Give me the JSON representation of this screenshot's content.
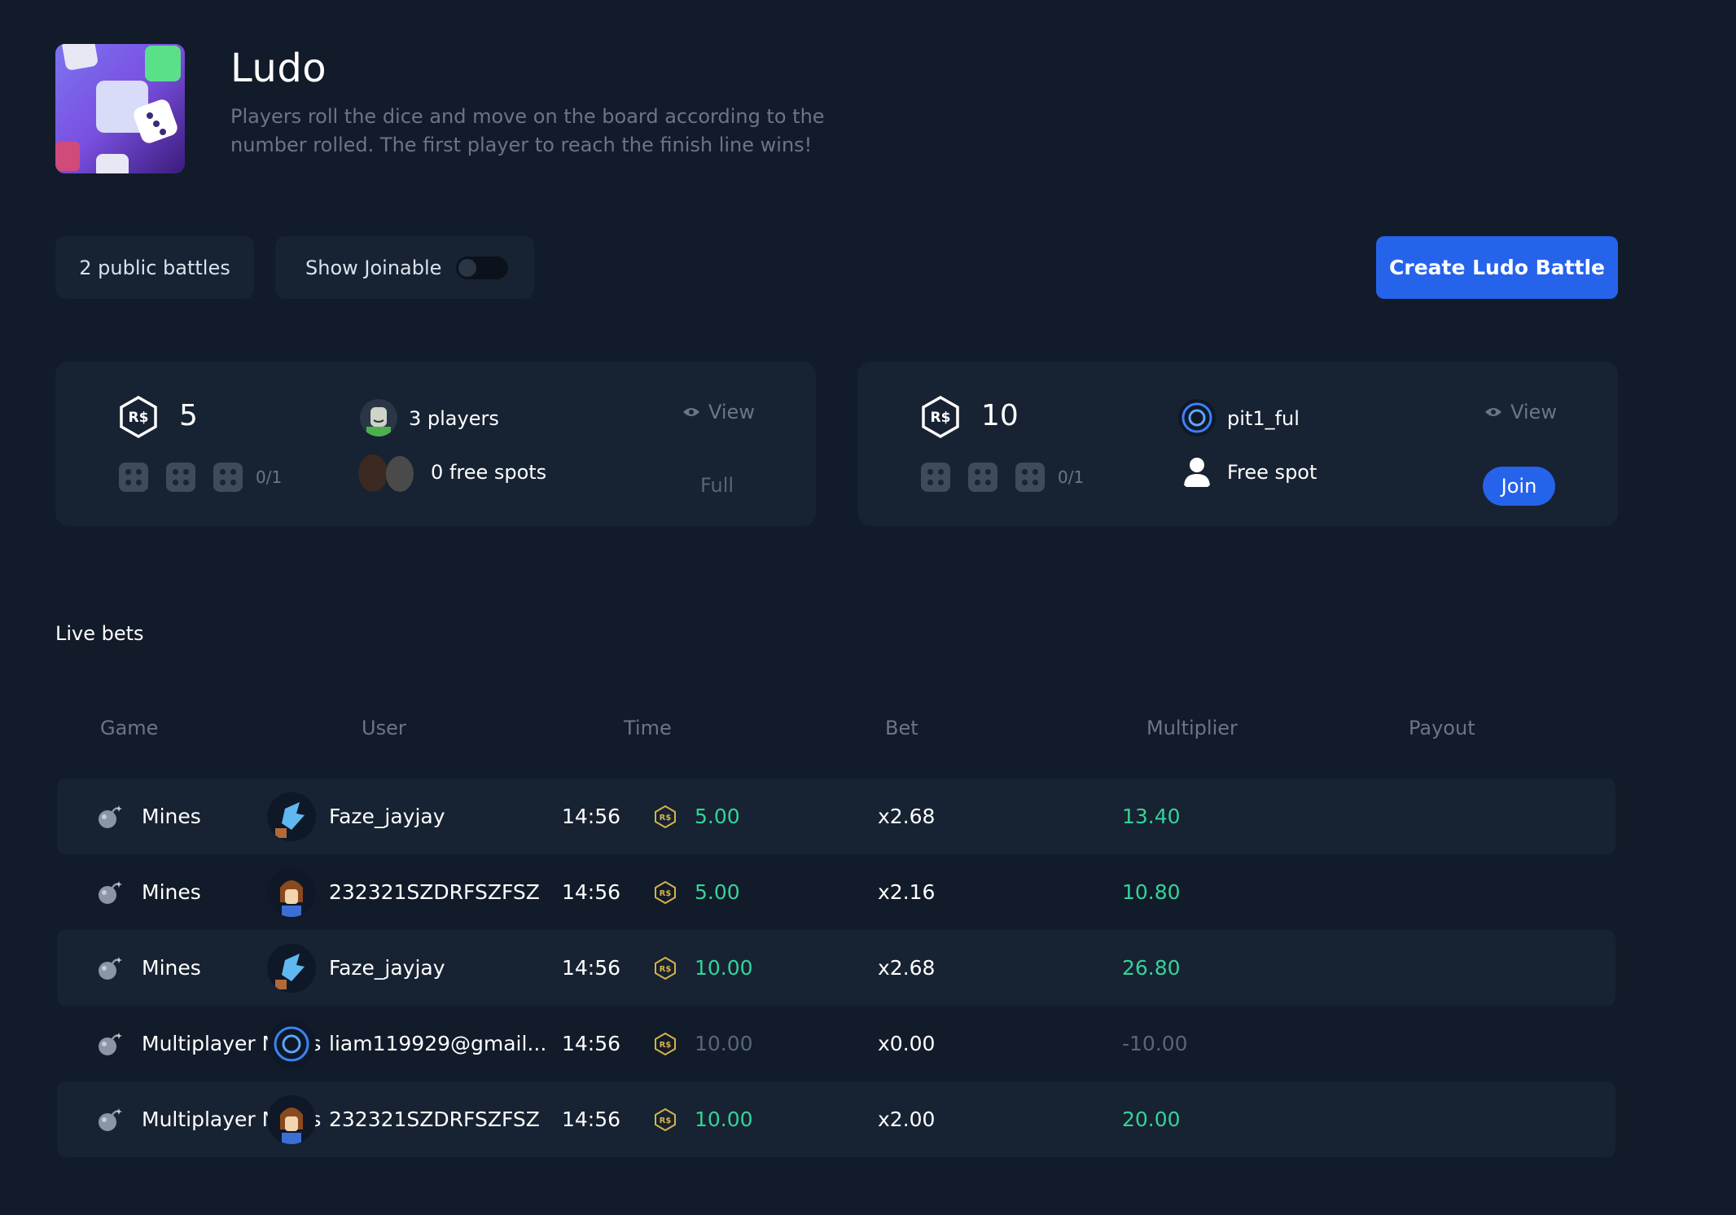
{
  "game": {
    "title": "Ludo",
    "description": "Players roll the dice and move on the board according to the number rolled. The first player to reach the finish line wins!"
  },
  "controls": {
    "public_battles_label": "2 public battles",
    "show_joinable_label": "Show Joinable",
    "show_joinable_on": false,
    "create_button_label": "Create Ludo Battle"
  },
  "currency_label": "R$",
  "battles": [
    {
      "amount": "5",
      "fraction": "0/1",
      "players_label": "3 players",
      "spots_label": "0 free spots",
      "view_label": "View",
      "status_label": "Full"
    },
    {
      "amount": "10",
      "fraction": "0/1",
      "players_label": "pit1_ful",
      "spots_label": "Free spot",
      "view_label": "View",
      "status_label": "Join"
    }
  ],
  "live_bets": {
    "title": "Live bets",
    "columns": [
      "Game",
      "User",
      "Time",
      "Bet",
      "Multiplier",
      "Payout"
    ],
    "rows": [
      {
        "game": "Mines",
        "user": "Faze_jayjay",
        "time": "14:56",
        "bet": "5.00",
        "multiplier": "x2.68",
        "payout": "13.40",
        "win": true
      },
      {
        "game": "Mines",
        "user": "232321SZDRFSZFSZ",
        "time": "14:56",
        "bet": "5.00",
        "multiplier": "x2.16",
        "payout": "10.80",
        "win": true
      },
      {
        "game": "Mines",
        "user": "Faze_jayjay",
        "time": "14:56",
        "bet": "10.00",
        "multiplier": "x2.68",
        "payout": "26.80",
        "win": true
      },
      {
        "game": "Multiplayer Mines",
        "user": "liam119929@gmail...",
        "time": "14:56",
        "bet": "10.00",
        "multiplier": "x0.00",
        "payout": "-10.00",
        "win": false
      },
      {
        "game": "Multiplayer Mines",
        "user": "232321SZDRFSZFSZ",
        "time": "14:56",
        "bet": "10.00",
        "multiplier": "x2.00",
        "payout": "20.00",
        "win": true
      }
    ]
  },
  "colors": {
    "background": "#121b29",
    "panel": "#172232",
    "accent": "#2563eb",
    "win": "#34d399",
    "muted": "#6b7586"
  }
}
